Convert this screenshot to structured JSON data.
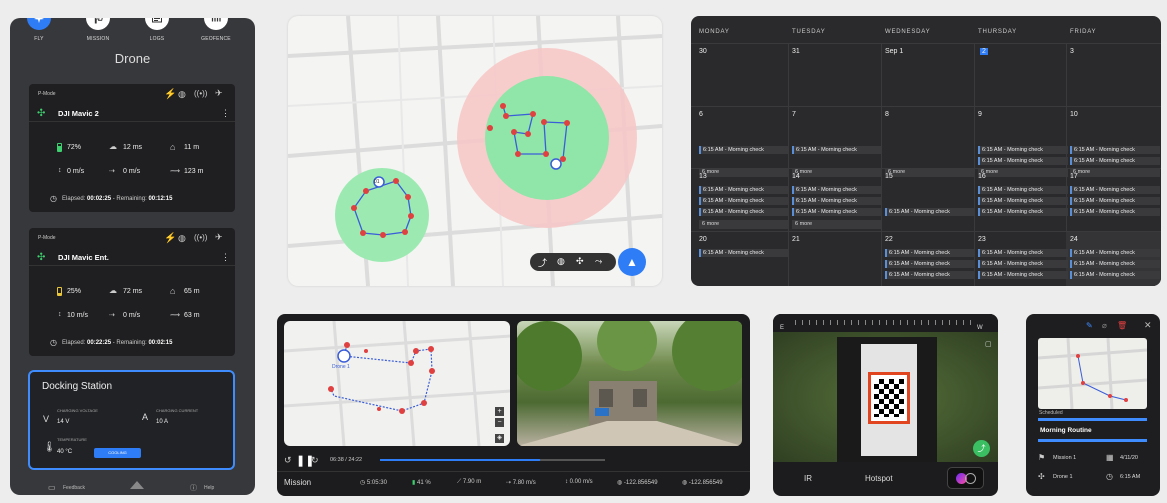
{
  "nav": {
    "items": [
      {
        "label": "FLY",
        "icon": "plane-icon",
        "active": true
      },
      {
        "label": "MISSION",
        "icon": "flag-icon"
      },
      {
        "label": "LOGS",
        "icon": "logs-icon"
      },
      {
        "label": "GEOFENCE",
        "icon": "geofence-icon"
      }
    ]
  },
  "left": {
    "title": "Drone",
    "drones": [
      {
        "mode": "P-Mode",
        "name": "DJI Mavic 2",
        "battery": "72%",
        "latency": "12 ms",
        "altitude": "11 m",
        "vspeed": "0 m/s",
        "hspeed": "0 m/s",
        "distance": "123 m",
        "elapsed_label": "Elapsed:",
        "elapsed": "00:02:25",
        "remaining_label": "Remaining:",
        "remaining": "00:12:15",
        "battery_level": 0.72
      },
      {
        "mode": "P-Mode",
        "name": "DJI Mavic Ent.",
        "battery": "25%",
        "latency": "72 ms",
        "altitude": "65 m",
        "vspeed": "10 m/s",
        "hspeed": "0 m/s",
        "distance": "63 m",
        "elapsed_label": "Elapsed:",
        "elapsed": "00:22:25",
        "remaining_label": "Remaining:",
        "remaining": "00:02:15",
        "battery_level": 0.25
      }
    ],
    "docking": {
      "title": "Docking Station",
      "voltage_label": "CHARGING VOLTAGE",
      "voltage": "14 V",
      "current_label": "CHARGING CURRENT",
      "current": "10 A",
      "temp_label": "TEMPERATURE",
      "temp": "40 °C",
      "status": "COOLING"
    },
    "footer": {
      "feedback": "Feedback",
      "help": "Help"
    }
  },
  "map": {
    "drone_label": "01",
    "tools": [
      "takeoff-icon",
      "globe-icon",
      "drone-icon",
      "route-icon"
    ],
    "action": "rocket-icon"
  },
  "calendar": {
    "days": [
      "MONDAY",
      "TUESDAY",
      "WEDNESDAY",
      "THURSDAY",
      "FRIDAY"
    ],
    "event": "6:15 AM - Morning check",
    "more": "6 more",
    "weeks": [
      [
        "30",
        "31",
        "Sep 1",
        "2",
        "3"
      ],
      [
        "6",
        "7",
        "8",
        "9",
        "10"
      ],
      [
        "13",
        "14",
        "15",
        "16",
        "17"
      ],
      [
        "20",
        "21",
        "22",
        "23",
        "24"
      ]
    ]
  },
  "mission": {
    "drone_label": "Drone 1",
    "time": "06:38 / 24:22",
    "progress": 0.71,
    "title": "Mission",
    "stats": [
      "5:05:30",
      "41 %",
      "7.90 m",
      "7.80 m/s",
      "0.00 m/s",
      "-122.856549",
      "-122.856549"
    ]
  },
  "ir": {
    "compass_left": "E",
    "compass_right": "W",
    "tab_ir": "IR",
    "tab_hotspot": "Hotspot"
  },
  "routine": {
    "section": "Scheduled",
    "name": "Morning Routine",
    "mission": "Mission 1",
    "date": "4/11/20",
    "drone": "Drone 1",
    "time": "6:15 AM"
  },
  "colors": {
    "accent": "#3f8cff",
    "panel": "#37383b",
    "card": "#1f1f21",
    "geofence_green": "#7fe3a0",
    "geofence_red": "#f3a0a0"
  }
}
